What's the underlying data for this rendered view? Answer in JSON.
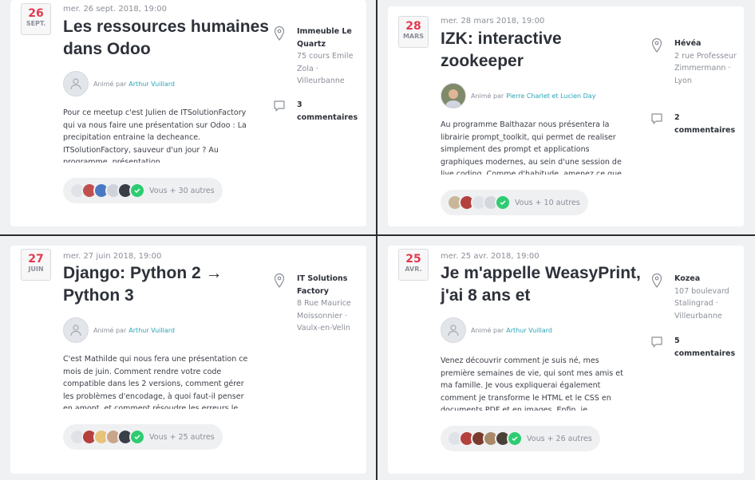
{
  "events": [
    {
      "day": "26",
      "month": "SEPT.",
      "datetime": "mer. 26 sept. 2018, 19:00",
      "title": "Les ressources humaines dans Odoo",
      "organized_prefix": "Animé par",
      "hosts": "Arthur Vuillard",
      "description": "Pour ce meetup c'est Julien de ITSolutionFactory qui va nous faire une présentation sur Odoo : La precipitation entraine la decheance. ITSolutionFactory, sauveur d'un jour ? Au programme, présentation",
      "venue": "Immeuble Le Quartz",
      "address": "75 cours Emile Zola · Villeurbanne",
      "comments_count": "3",
      "comments_label": "commentaires",
      "attendees_label": "Vous + 30 autres"
    },
    {
      "day": "28",
      "month": "MARS",
      "datetime": "mer. 28 mars 2018, 19:00",
      "title": "IZK: interactive zookeeper",
      "organized_prefix": "Animé par",
      "hosts": "Pierre Charlet et Lucien Day",
      "description": "Au programme Balthazar nous présentera la librairie prompt_toolkit, qui permet de realiser simplement des prompt et applications graphiques modernes, au sein d'une session de live coding. Comme d'habitude, amenez ce que",
      "venue": "Hévéa",
      "address": "2 rue Professeur Zimmermann · Lyon",
      "comments_count": "2",
      "comments_label": "commentaires",
      "attendees_label": "Vous + 10 autres"
    },
    {
      "day": "27",
      "month": "JUIN",
      "datetime": "mer. 27 juin 2018, 19:00",
      "title": "Django: Python 2 → Python 3",
      "organized_prefix": "Animé par",
      "hosts": "Arthur Vuillard",
      "description": "C'est Mathilde qui nous fera une présentation ce mois de juin. Comment rendre votre code compatible dans les 2 versions, comment gérer les problèmes d'encodage, à quoi faut-il penser en amont, et comment résoudre les erreurs le",
      "venue": "IT Solutions Factory",
      "address": "8 Rue Maurice Moissonnier · Vaulx-en-Velin",
      "comments_count": "",
      "comments_label": "",
      "attendees_label": "Vous + 25 autres"
    },
    {
      "day": "25",
      "month": "AVR.",
      "datetime": "mer. 25 avr. 2018, 19:00",
      "title": "Je m'appelle WeasyPrint, j'ai 8 ans et",
      "organized_prefix": "Animé par",
      "hosts": "Arthur Vuillard",
      "description": "Venez découvrir comment je suis né, mes première semaines de vie, qui sont mes amis et ma famille. Je vous expliquerai également comment je transforme le HTML et le CSS en documents PDF et en images. Enfin, je",
      "venue": "Kozea",
      "address": "107 boulevard Stalingrad · Villeurbanne",
      "comments_count": "5",
      "comments_label": "commentaires",
      "attendees_label": "Vous + 26 autres"
    }
  ],
  "icons": {
    "location": "map-pin-icon",
    "comments": "speech-bubble-icon",
    "user": "user-placeholder-icon",
    "check": "check-icon"
  },
  "colors": {
    "date_accent": "#e4394f",
    "link": "#2aa5b8",
    "check": "#2ecc71"
  }
}
